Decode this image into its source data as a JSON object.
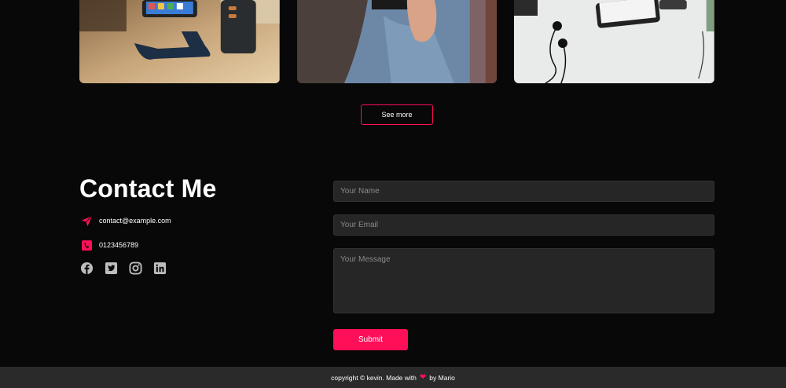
{
  "gallery": {
    "images": [
      {
        "alt": "phone-on-charging-stand"
      },
      {
        "alt": "person-holding-phone"
      },
      {
        "alt": "phone-and-earphones"
      }
    ],
    "see_more_label": "See more"
  },
  "contact": {
    "title": "Contact Me",
    "email": "contact@example.com",
    "phone": "0123456789",
    "socials": [
      "facebook-icon",
      "twitter-icon",
      "instagram-icon",
      "linkedin-icon"
    ]
  },
  "form": {
    "name_placeholder": "Your Name",
    "email_placeholder": "Your Email",
    "message_placeholder": "Your Message",
    "submit_label": "Submit"
  },
  "footer": {
    "prefix": "copyright © kevin. Made with",
    "suffix": "by Mario"
  },
  "colors": {
    "accent": "#ff0f57",
    "background": "#080808",
    "field": "#262626",
    "footer": "#2a2a2a"
  }
}
